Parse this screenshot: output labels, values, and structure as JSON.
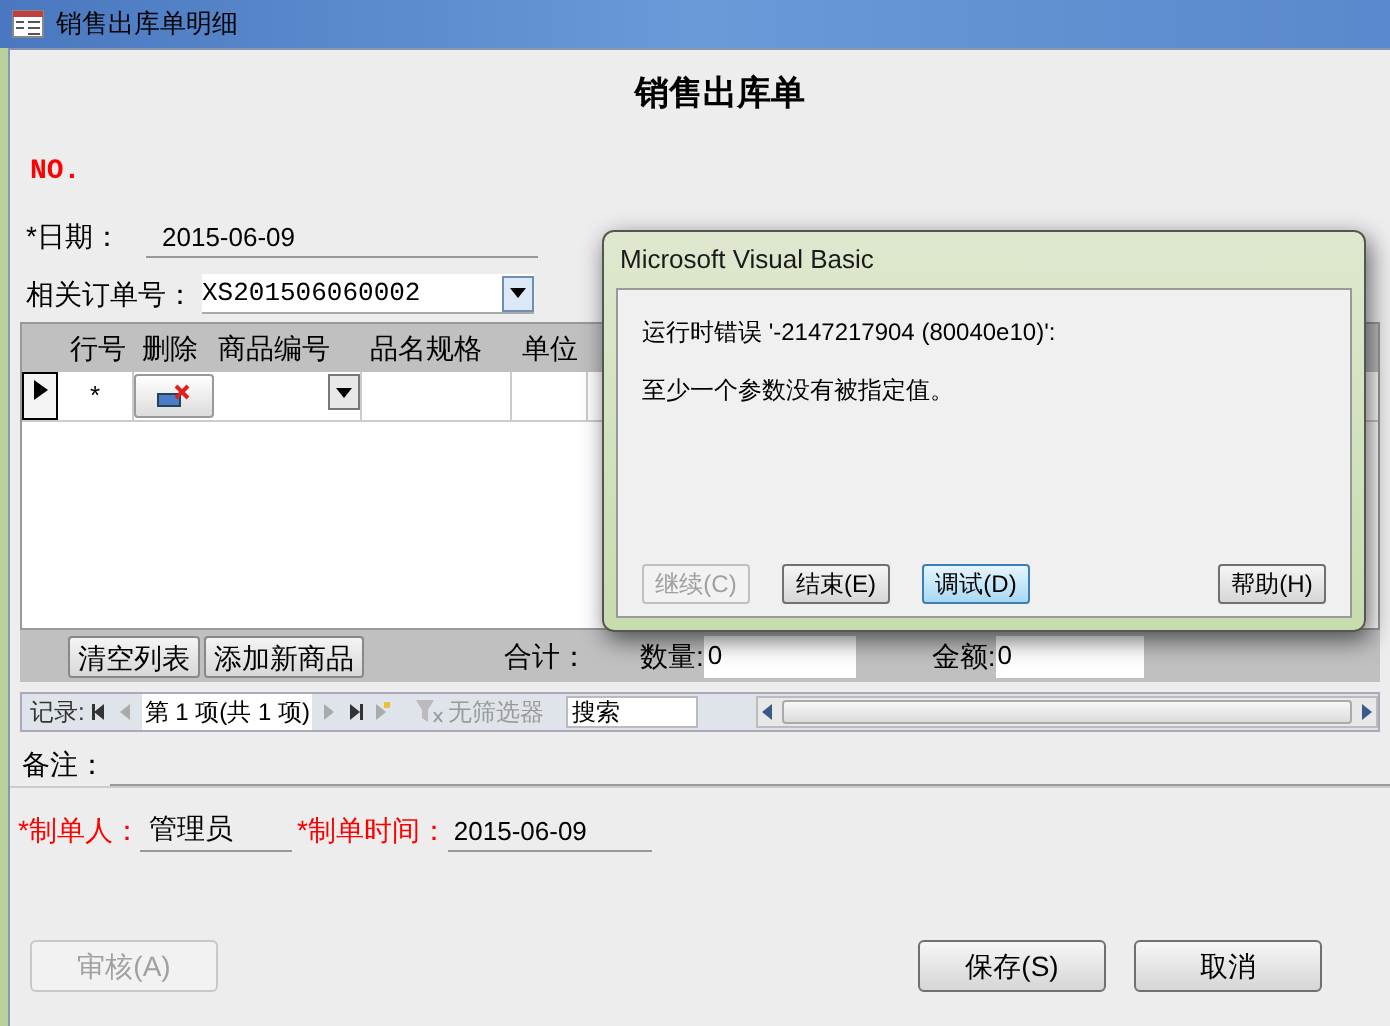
{
  "window": {
    "title": "销售出库单明细"
  },
  "form_title": "销售出库单",
  "number_label": "NO.",
  "date": {
    "label": "*日期：",
    "value": "2015-06-09"
  },
  "order": {
    "label": "相关订单号：",
    "value": "XS201506060002"
  },
  "grid": {
    "columns": [
      "行号",
      "删除",
      "商品编号",
      "品名规格",
      "单位"
    ],
    "rows": [
      {
        "selected": true,
        "row_no": "*"
      }
    ]
  },
  "grid_footer": {
    "buttons": [
      "清空列表",
      "添加新商品"
    ],
    "total_label": "合计：",
    "quantity": {
      "label": "数量:",
      "value": "0"
    },
    "amount": {
      "label": "金额:",
      "value": "0"
    }
  },
  "record_nav": {
    "label": "记录:",
    "position": "第 1 项(共 1 项)",
    "filter": "无筛选器",
    "search_placeholder": "搜索"
  },
  "remarks": {
    "label": "备注："
  },
  "creator": {
    "label": "*制单人：",
    "value": "管理员"
  },
  "created_time": {
    "label": "*制单时间：",
    "value": "2015-06-09"
  },
  "buttons": [
    {
      "label": "审核(A)",
      "disabled": true
    },
    {
      "label": "保存(S)",
      "disabled": false
    },
    {
      "label": "取消",
      "disabled": false
    }
  ],
  "dialog": {
    "title": "Microsoft Visual Basic",
    "message": [
      "运行时错误 '-2147217904 (80040e10)':",
      "至少一个参数没有被指定值。"
    ],
    "buttons": [
      {
        "label": "继续(C)",
        "disabled": true,
        "focused": false
      },
      {
        "label": "结束(E)",
        "disabled": false,
        "focused": false
      },
      {
        "label": "调试(D)",
        "disabled": false,
        "focused": true
      },
      {
        "label": "帮助(H)",
        "disabled": false,
        "focused": false
      }
    ]
  }
}
